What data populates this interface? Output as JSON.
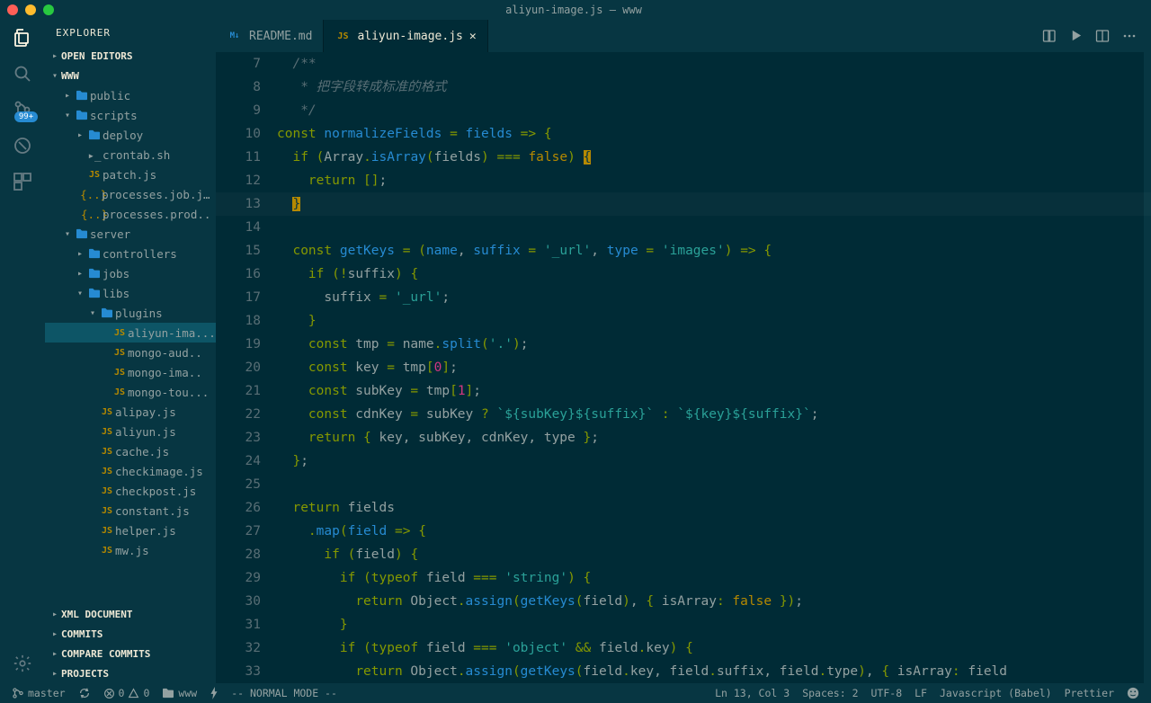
{
  "title": "aliyun-image.js — www",
  "sidebar": {
    "title": "EXPLORER",
    "sections": {
      "open_editors": "OPEN EDITORS",
      "root": "WWW",
      "xml": "XML DOCUMENT",
      "commits": "COMMITS",
      "compare": "COMPARE COMMITS",
      "projects": "PROJECTS"
    },
    "tree": [
      {
        "depth": 1,
        "caret": "▸",
        "icon": "fld",
        "label": "public"
      },
      {
        "depth": 1,
        "caret": "▾",
        "icon": "fld",
        "label": "scripts"
      },
      {
        "depth": 2,
        "caret": "▸",
        "icon": "fld",
        "label": "deploy"
      },
      {
        "depth": 2,
        "caret": "",
        "icon": "sh",
        "label": "crontab.sh"
      },
      {
        "depth": 2,
        "caret": "",
        "icon": "js",
        "label": "patch.js"
      },
      {
        "depth": 2,
        "caret": "",
        "icon": "json",
        "label": "processes.job.j..."
      },
      {
        "depth": 2,
        "caret": "",
        "icon": "json",
        "label": "processes.prod.."
      },
      {
        "depth": 1,
        "caret": "▾",
        "icon": "fld",
        "label": "server"
      },
      {
        "depth": 2,
        "caret": "▸",
        "icon": "fld",
        "label": "controllers"
      },
      {
        "depth": 2,
        "caret": "▸",
        "icon": "fld",
        "label": "jobs"
      },
      {
        "depth": 2,
        "caret": "▾",
        "icon": "fld",
        "label": "libs"
      },
      {
        "depth": 3,
        "caret": "▾",
        "icon": "fld",
        "label": "plugins"
      },
      {
        "depth": 4,
        "caret": "",
        "icon": "js",
        "label": "aliyun-ima...",
        "active": true
      },
      {
        "depth": 4,
        "caret": "",
        "icon": "js",
        "label": "mongo-aud.."
      },
      {
        "depth": 4,
        "caret": "",
        "icon": "js",
        "label": "mongo-ima.."
      },
      {
        "depth": 4,
        "caret": "",
        "icon": "js",
        "label": "mongo-tou..."
      },
      {
        "depth": 3,
        "caret": "",
        "icon": "js",
        "label": "alipay.js"
      },
      {
        "depth": 3,
        "caret": "",
        "icon": "js",
        "label": "aliyun.js"
      },
      {
        "depth": 3,
        "caret": "",
        "icon": "js",
        "label": "cache.js"
      },
      {
        "depth": 3,
        "caret": "",
        "icon": "js",
        "label": "checkimage.js"
      },
      {
        "depth": 3,
        "caret": "",
        "icon": "js",
        "label": "checkpost.js"
      },
      {
        "depth": 3,
        "caret": "",
        "icon": "js",
        "label": "constant.js"
      },
      {
        "depth": 3,
        "caret": "",
        "icon": "js",
        "label": "helper.js"
      },
      {
        "depth": 3,
        "caret": "",
        "icon": "js",
        "label": "mw.js"
      }
    ]
  },
  "tabs": [
    {
      "icon": "md",
      "label": "README.md",
      "active": false
    },
    {
      "icon": "js",
      "label": "aliyun-image.js",
      "active": true
    }
  ],
  "lines_start": 7,
  "badge99": "99+",
  "status": {
    "branch": "master",
    "errors": "0",
    "warnings": "0",
    "folder": "www",
    "mode": "-- NORMAL MODE --",
    "pos": "Ln 13, Col 3",
    "spaces": "Spaces: 2",
    "encoding": "UTF-8",
    "eol": "LF",
    "lang": "Javascript (Babel)",
    "prettier": "Prettier"
  }
}
